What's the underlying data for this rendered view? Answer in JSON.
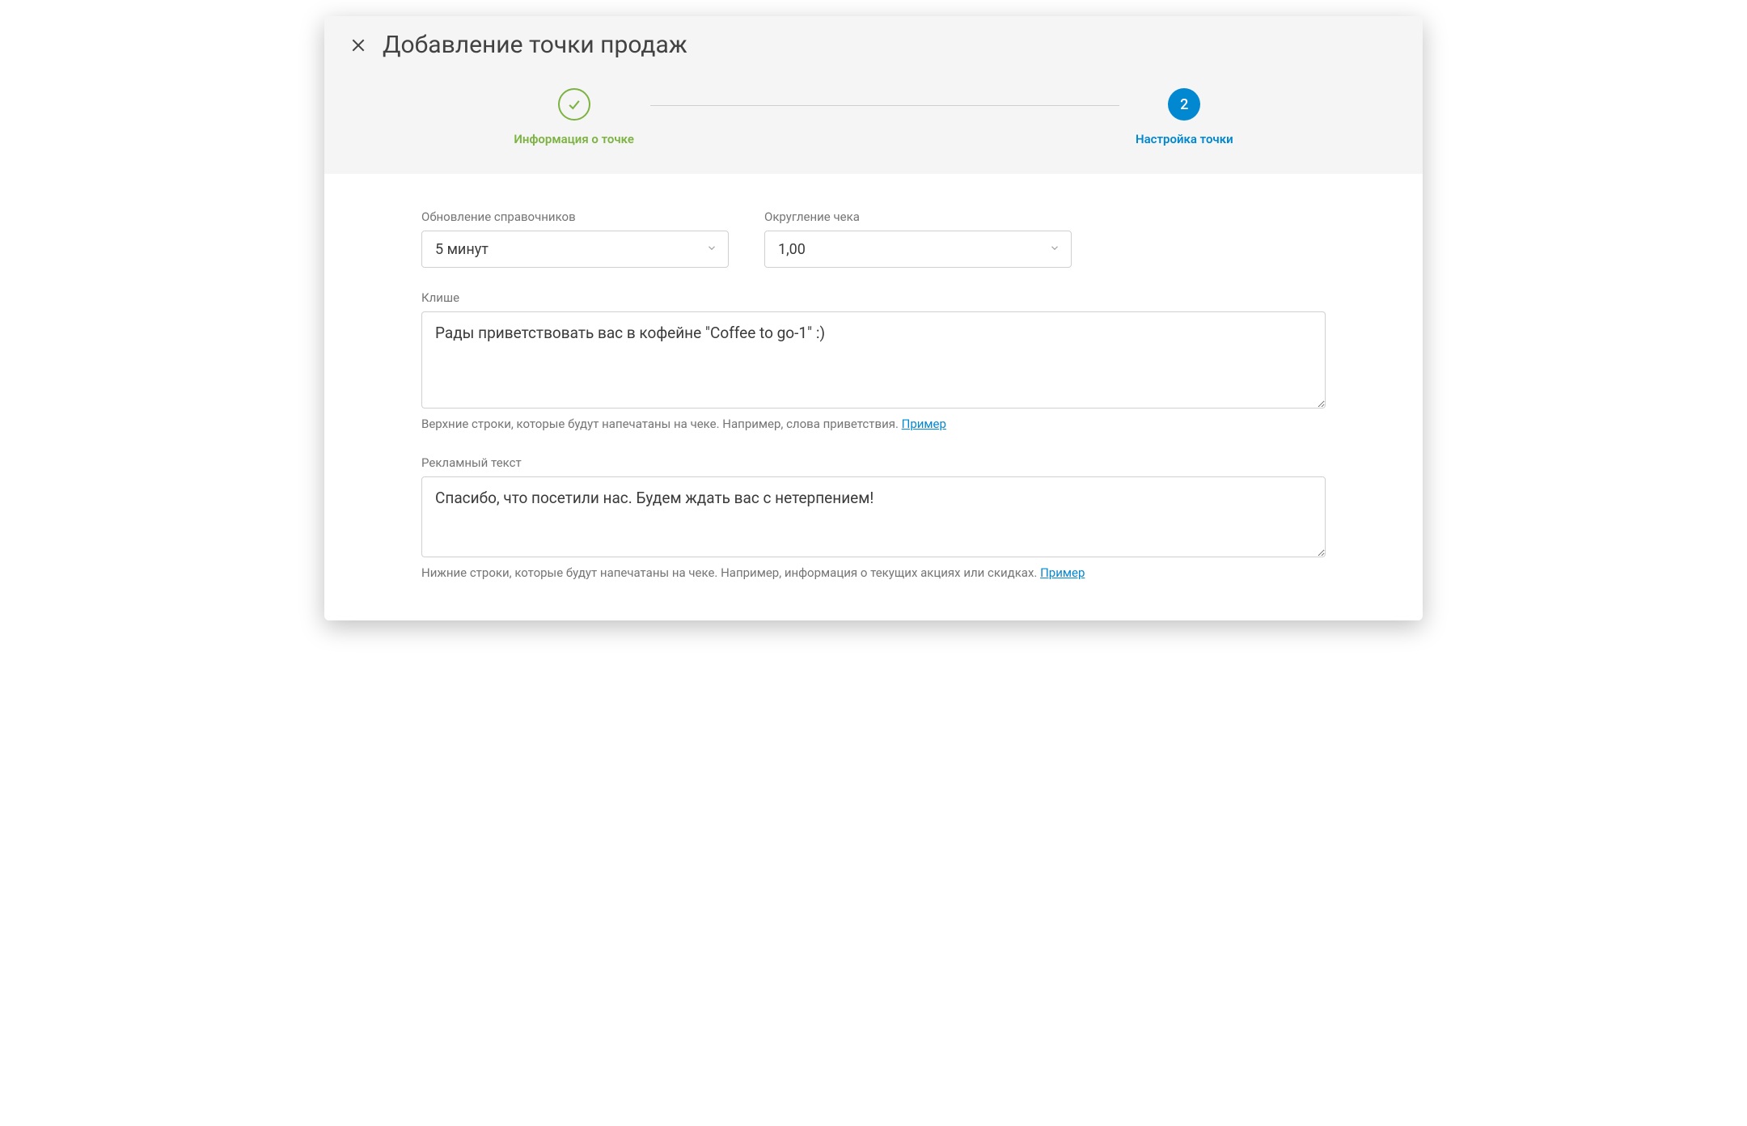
{
  "modal": {
    "title": "Добавление точки продаж"
  },
  "stepper": {
    "step1": {
      "label": "Информация о точке"
    },
    "step2": {
      "number": "2",
      "label": "Настройка точки"
    }
  },
  "form": {
    "update_refs": {
      "label": "Обновление справочников",
      "value": "5 минут"
    },
    "rounding": {
      "label": "Округление чека",
      "value": "1,00"
    },
    "cliche": {
      "label": "Клише",
      "value": "Рады приветствовать вас в кофейне \"Coffee to go-1\" :)",
      "help": "Верхние строки, которые будут напечатаны на чеке. Например, слова приветствия. ",
      "example_link": "Пример"
    },
    "ad_text": {
      "label": "Рекламный текст",
      "value": "Спасибо, что посетили нас. Будем ждать вас с нетерпением!",
      "help": "Нижние строки, которые будут напечатаны на чеке. Например, информация о текущих акциях или скидках. ",
      "example_link": "Пример"
    }
  }
}
